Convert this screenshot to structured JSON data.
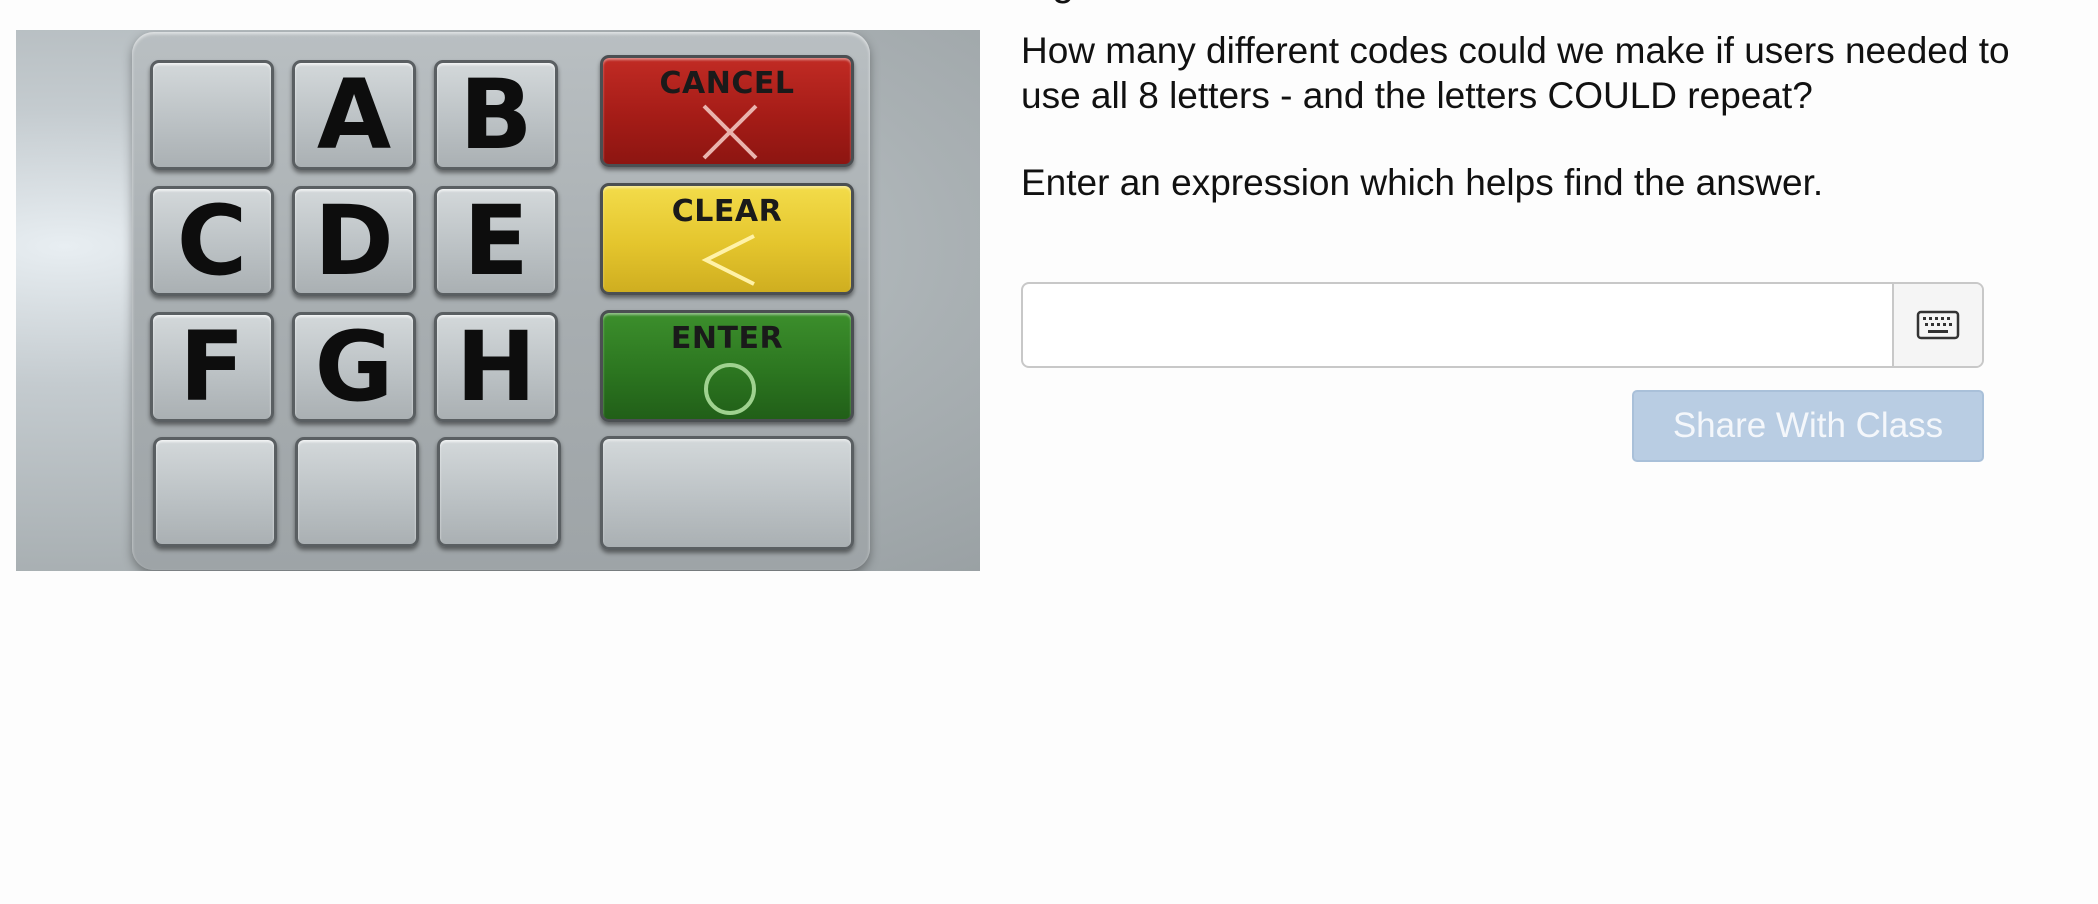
{
  "keypad": {
    "letter_keys": [
      "A",
      "B",
      "C",
      "D",
      "E",
      "F",
      "G",
      "H"
    ],
    "cancel_label": "CANCEL",
    "clear_label": "CLEAR",
    "enter_label": "ENTER",
    "colors": {
      "cancel": "#a51c17",
      "clear": "#e4c52d",
      "enter": "#2c7620"
    }
  },
  "question": {
    "text": "How many different codes could we make if users needed to use all 8 letters - and the letters COULD repeat?",
    "instruction": "Enter an expression which helps find the answer."
  },
  "answer": {
    "value": "",
    "keyboard_icon": "keyboard-icon"
  },
  "share_button": {
    "label": "Share With Class",
    "color": "#b9cde3"
  }
}
